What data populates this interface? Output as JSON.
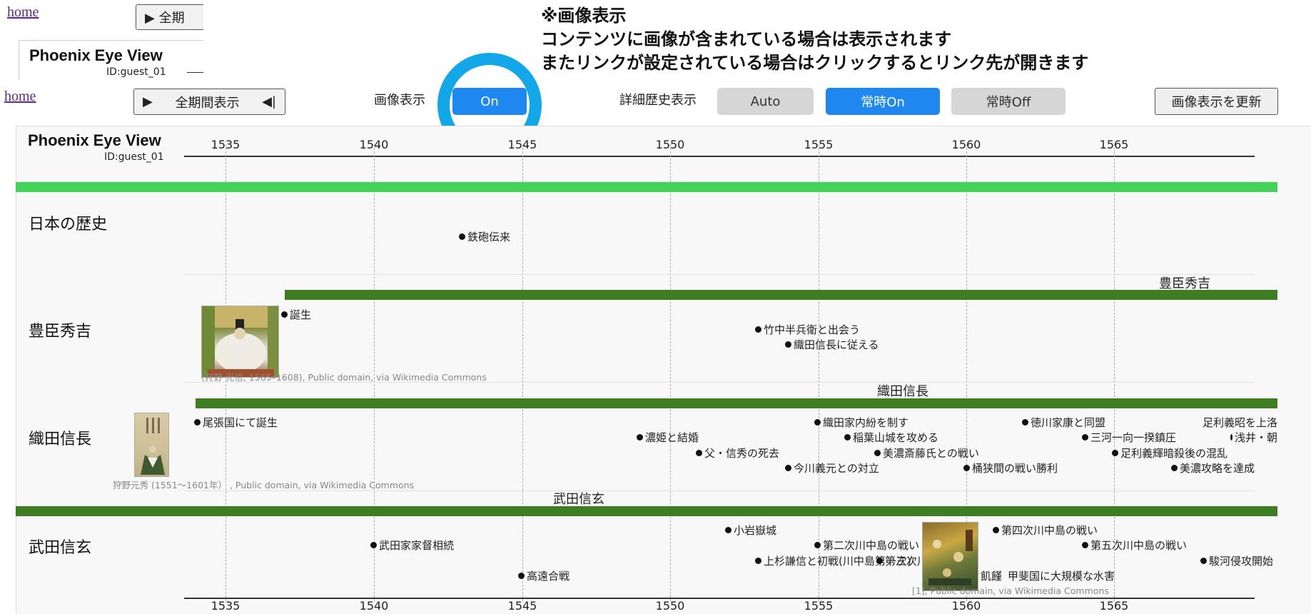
{
  "bg": {
    "home": "home",
    "period_label": "▶ 全期",
    "title": "Phoenix Eye View",
    "id": "ID:guest_01"
  },
  "note": {
    "line1": "※画像表示",
    "line2": "コンテンツに画像が含まれている場合は表示されます",
    "line3": "またリンクが設定されている場合はクリックするとリンク先が開きます"
  },
  "toolbar": {
    "home": "home",
    "period_button": "全期間表示",
    "image_label": "画像表示",
    "image_toggle": "On",
    "detail_label": "詳細歴史表示",
    "detail_auto": "Auto",
    "detail_on": "常時On",
    "detail_off": "常時Off",
    "refresh": "画像表示を更新"
  },
  "panel": {
    "title": "Phoenix Eye View",
    "id": "ID:guest_01"
  },
  "axis": {
    "ticks": [
      "1535",
      "1540",
      "1545",
      "1550",
      "1555",
      "1560",
      "1565"
    ]
  },
  "rows": {
    "japan": {
      "label": "日本の歴史"
    },
    "hideyoshi": {
      "label": "豊臣秀吉",
      "bar_label": "豊臣秀吉",
      "credit": "(狩野 光信, 1565–1608), Public domain, via Wikimedia Commons"
    },
    "nobunaga": {
      "label": "織田信長",
      "bar_label": "織田信長",
      "credit": "狩野元秀 (1551～1601年） , Public domain, via Wikimedia Commons"
    },
    "shingen": {
      "label": "武田信玄",
      "bar_label": "武田信玄",
      "credit": "[1], Public domain, via Wikimedia Commons"
    }
  },
  "events": {
    "japan": [
      "鉄砲伝来"
    ],
    "hideyoshi": [
      "誕生",
      "竹中半兵衛と出会う",
      "織田信長に従える"
    ],
    "nobunaga": [
      "尾張国にて誕生",
      "濃姫と結婚",
      "父・信秀の死去",
      "織田家内紛を制す",
      "稲葉山城を攻める",
      "美濃斎藤氏との戦い",
      "今川義元との対立",
      "桶狭間の戦い勝利",
      "徳川家康と同盟",
      "三河一向一揆鎮圧",
      "足利義輝暗殺後の混乱",
      "美濃攻略を達成",
      "足利義昭を上洛",
      "浅井・朝"
    ],
    "shingen": [
      "小岩嶽城",
      "武田家家督相続",
      "第二次川中島の戦い",
      "上杉謙信と初戦(川中島第一次)",
      "第三次川",
      "高遠合戦",
      "第四次川中島の戦い",
      "第五次川中島の戦い",
      "飢饉",
      "甲斐国に大規模な水害",
      "駿河侵攻開始"
    ]
  },
  "colors": {
    "accent_blue": "#1e88f0",
    "ring": "#11a7e8",
    "bar_light": "#43d359",
    "bar_dark": "#3e7d21"
  }
}
